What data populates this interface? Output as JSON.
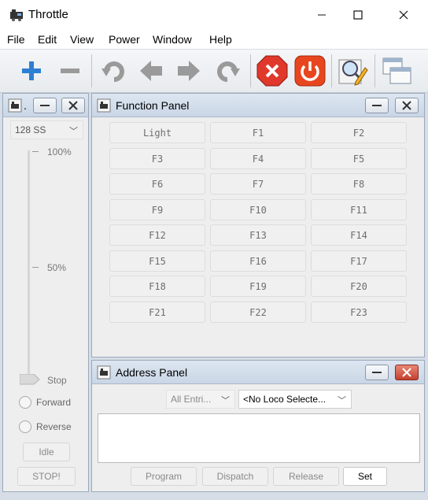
{
  "window": {
    "title": "Throttle"
  },
  "menu": [
    "File",
    "Edit",
    "View",
    "Power",
    "Window",
    "Help"
  ],
  "throttle": {
    "title": ".",
    "speed_steps": "128 SS",
    "scale": {
      "top": "100%",
      "mid": "50%",
      "bottom": "Stop"
    },
    "speed_level": 0,
    "forward_label": "Forward",
    "reverse_label": "Reverse",
    "idle_label": "Idle",
    "stop_label": "STOP!"
  },
  "function_panel": {
    "title": "Function Panel",
    "buttons": [
      "Light",
      "F1",
      "F2",
      "F3",
      "F4",
      "F5",
      "F6",
      "F7",
      "F8",
      "F9",
      "F10",
      "F11",
      "F12",
      "F13",
      "F14",
      "F15",
      "F16",
      "F17",
      "F18",
      "F19",
      "F20",
      "F21",
      "F22",
      "F23"
    ]
  },
  "address_panel": {
    "title": "Address Panel",
    "roster_filter": "All Entri...",
    "loco_select": "<No Loco Selecte...",
    "program_label": "Program",
    "dispatch_label": "Dispatch",
    "release_label": "Release",
    "set_label": "Set"
  },
  "icons": {
    "app": "train-icon",
    "toolbar": [
      "plus-icon",
      "minus-icon",
      "rotate-left-icon",
      "arrow-left-icon",
      "arrow-right-icon",
      "rotate-right-icon",
      "stop-icon",
      "power-icon",
      "edit-magnify-icon",
      "windows-icon"
    ]
  },
  "colors": {
    "stop_red": "#e0382b",
    "power_red": "#e8461e",
    "plus_blue": "#2d7fd3",
    "title_gradient": "#c9d6e6"
  }
}
